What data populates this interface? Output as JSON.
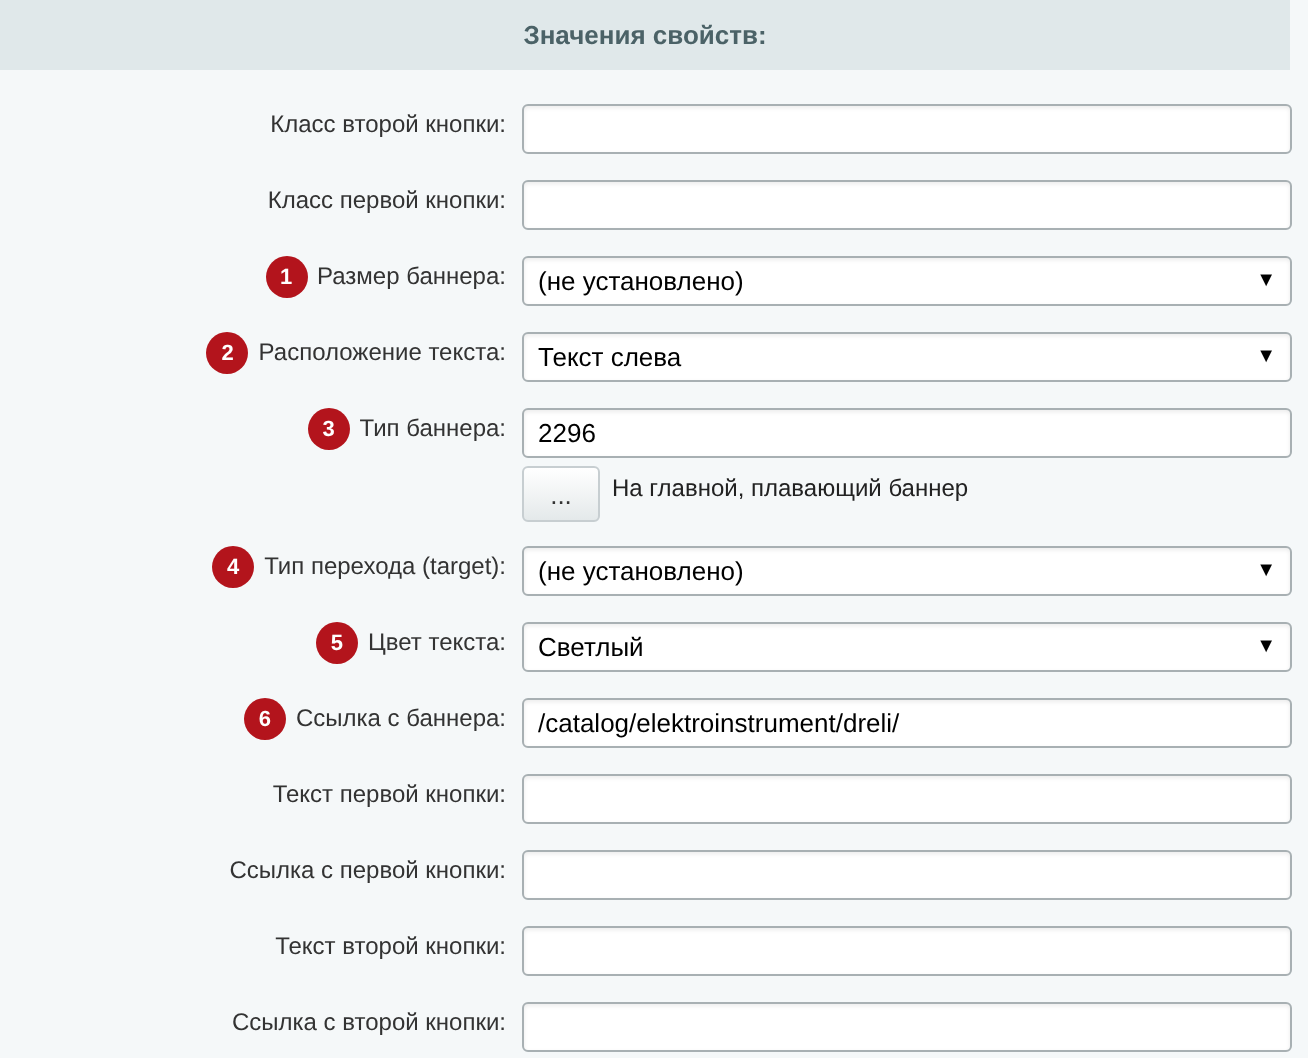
{
  "header": {
    "title": "Значения свойств:"
  },
  "rows": [
    {
      "kind": "text",
      "label": "Класс второй кнопки:",
      "value": ""
    },
    {
      "kind": "text",
      "label": "Класс первой кнопки:",
      "value": ""
    },
    {
      "kind": "select",
      "badge": "1",
      "label": "Размер баннера:",
      "value": "(не установлено)",
      "arrow": "▼"
    },
    {
      "kind": "select",
      "badge": "2",
      "label": "Расположение текста:",
      "value": "Текст слева",
      "arrow": "▼"
    },
    {
      "kind": "picker",
      "badge": "3",
      "label": "Тип баннера:",
      "value": "2296",
      "button": "...",
      "note": "На главной, плавающий баннер"
    },
    {
      "kind": "select",
      "badge": "4",
      "label": "Тип перехода (target):",
      "value": "(не установлено)",
      "arrow": "▼"
    },
    {
      "kind": "select",
      "badge": "5",
      "label": "Цвет текста:",
      "value": "Светлый",
      "arrow": "▼"
    },
    {
      "kind": "text",
      "badge": "6",
      "label": "Ссылка с баннера:",
      "value": "/catalog/elektroinstrument/dreli/"
    },
    {
      "kind": "text",
      "label": "Текст первой кнопки:",
      "value": ""
    },
    {
      "kind": "text",
      "label": "Ссылка с первой кнопки:",
      "value": ""
    },
    {
      "kind": "text",
      "label": "Текст второй кнопки:",
      "value": ""
    },
    {
      "kind": "text",
      "label": "Ссылка с второй кнопки:",
      "value": ""
    }
  ]
}
